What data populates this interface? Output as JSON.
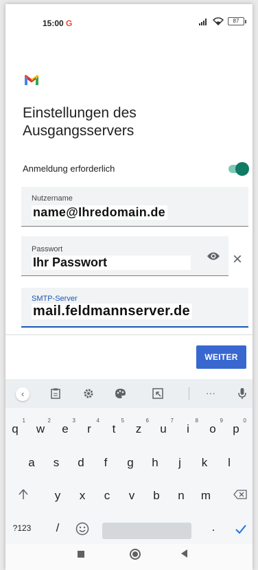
{
  "status_bar": {
    "time": "15:00",
    "google_badge": "G",
    "battery": "87"
  },
  "app": {
    "logo_icon": "gmail-logo"
  },
  "title": "Einstellungen des Ausgangsservers",
  "auth": {
    "label": "Anmeldung erforderlich",
    "enabled": true
  },
  "fields": {
    "username": {
      "label": "Nutzername",
      "value": "name@Ihredomain.de"
    },
    "password": {
      "label": "Passwort",
      "value": "Ihr Passwort"
    },
    "smtp": {
      "label": "SMTP-Server",
      "value": "mail.feldmannserver.de"
    }
  },
  "next_button": "WEITER",
  "keyboard": {
    "row1": [
      "q",
      "w",
      "e",
      "r",
      "t",
      "z",
      "u",
      "i",
      "o",
      "p"
    ],
    "row1_hints": [
      "1",
      "2",
      "3",
      "4",
      "5",
      "6",
      "7",
      "8",
      "9",
      "0"
    ],
    "row2": [
      "a",
      "s",
      "d",
      "f",
      "g",
      "h",
      "j",
      "k",
      "l"
    ],
    "row3": [
      "y",
      "x",
      "c",
      "v",
      "b",
      "n",
      "m"
    ],
    "symbols_key": "?123",
    "slash_key": "/",
    "period_key": "."
  },
  "colors": {
    "accent": "#3967d0",
    "toggle_on": "#0f7b63",
    "focused_field": "#1a55b7"
  }
}
